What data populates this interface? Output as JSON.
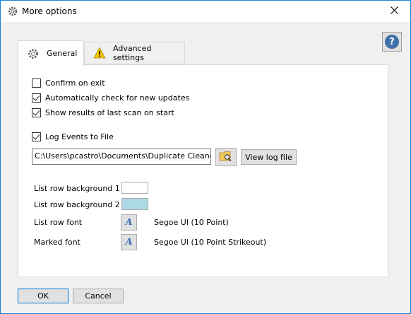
{
  "window": {
    "title": "More options",
    "icon": "gear-icon",
    "close_icon": "close-icon"
  },
  "help": {
    "label": "?"
  },
  "tabs": [
    {
      "label": "General",
      "icon": "gear-icon",
      "active": true
    },
    {
      "label": "Advanced settings",
      "icon": "warning-icon",
      "active": false
    }
  ],
  "options": {
    "confirm_exit": {
      "label": "Confirm on exit",
      "checked": false
    },
    "auto_update": {
      "label": "Automatically check for new updates",
      "checked": true
    },
    "show_results": {
      "label": "Show results of last scan on start",
      "checked": true
    },
    "log_events": {
      "label": "Log Events to File",
      "checked": true
    }
  },
  "log": {
    "path_value": "C:\\Users\\pcastro\\Documents\\Duplicate Cleaner lo",
    "browse_icon": "folder-search-icon",
    "view_button": "View log file"
  },
  "appearance": {
    "row_bg1_label": "List row background 1",
    "row_bg1_color": "#ffffff",
    "row_bg2_label": "List row background 2",
    "row_bg2_color": "#add8e6",
    "row_font_label": "List row font",
    "row_font_value": "Segoe UI (10 Point)",
    "marked_font_label": "Marked font",
    "marked_font_value": "Segoe UI (10 Point Strikeout)",
    "font_button_glyph": "A"
  },
  "buttons": {
    "ok": "OK",
    "cancel": "Cancel"
  }
}
